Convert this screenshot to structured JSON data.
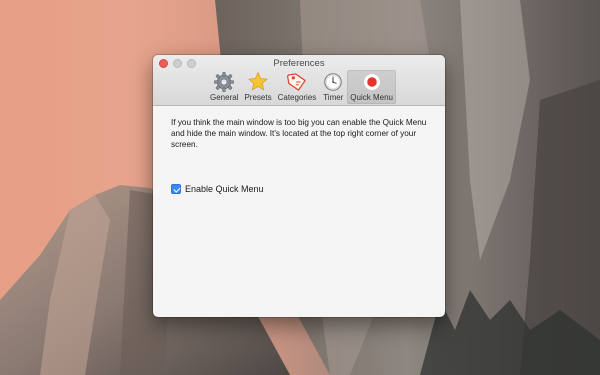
{
  "window": {
    "title": "Preferences"
  },
  "toolbar": {
    "items": [
      {
        "label": "General",
        "icon": "gear-icon"
      },
      {
        "label": "Presets",
        "icon": "star-icon"
      },
      {
        "label": "Categories",
        "icon": "tag-icon"
      },
      {
        "label": "Timer",
        "icon": "clock-icon"
      },
      {
        "label": "Quick Menu",
        "icon": "record-icon",
        "selected": true
      }
    ]
  },
  "quick_menu": {
    "description": "If you think the main window is too big you can enable the Quick Menu and hide the main window. It's located at the top right corner of your screen.",
    "checkbox_label": "Enable Quick Menu",
    "checkbox_checked": true
  },
  "colors": {
    "accent": "#3b88f5",
    "close_button": "#ee5c53"
  }
}
